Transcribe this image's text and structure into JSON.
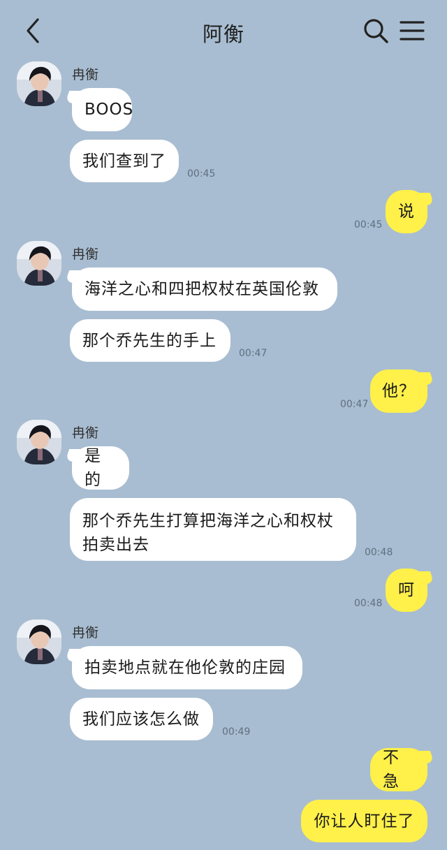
{
  "header": {
    "title": "阿衡"
  },
  "contact": {
    "name": "冉衡"
  },
  "messages": [
    {
      "text": "BOOS"
    },
    {
      "text": "我们查到了",
      "time": "00:45"
    },
    {
      "text": "说",
      "time": "00:45"
    },
    {
      "text": "海洋之心和四把权杖在英国伦敦"
    },
    {
      "text": "那个乔先生的手上",
      "time": "00:47"
    },
    {
      "text": "他？",
      "time": "00:47"
    },
    {
      "text": "是的"
    },
    {
      "text": "那个乔先生打算把海洋之心和权杖拍卖出去",
      "time": "00:48"
    },
    {
      "text": "呵",
      "time": "00:48"
    },
    {
      "text": "拍卖地点就在他伦敦的庄园"
    },
    {
      "text": "我们应该怎么做",
      "time": "00:49"
    },
    {
      "text": "不急"
    },
    {
      "text": "你让人盯住了"
    }
  ],
  "colors": {
    "background": "#a8bdd1",
    "incoming": "#ffffff",
    "outgoing": "#fff04a"
  },
  "icons": [
    "back-arrow-icon",
    "search-icon",
    "menu-icon"
  ]
}
